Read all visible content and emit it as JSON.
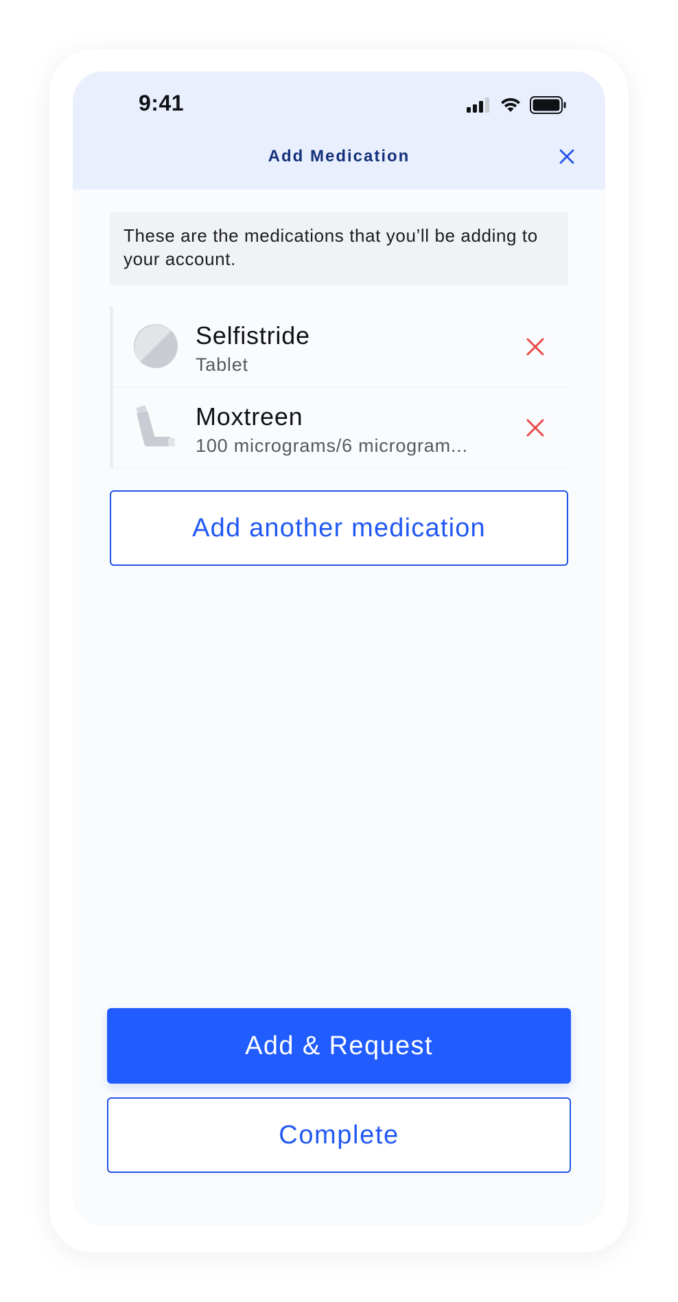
{
  "status_bar": {
    "time": "9:41",
    "icons": [
      "cellular-signal-icon",
      "wifi-icon",
      "battery-icon"
    ]
  },
  "header": {
    "title": "Add Medication",
    "close_icon": "close-icon"
  },
  "info_text": "These are the medications that you’ll be adding to your account.",
  "medications": [
    {
      "name": "Selfistride",
      "detail": "Tablet",
      "icon": "tablet-icon",
      "remove_icon": "remove-icon"
    },
    {
      "name": "Moxtreen",
      "detail": "100 micrograms/6 microgram...",
      "icon": "inhaler-icon",
      "remove_icon": "remove-icon"
    }
  ],
  "buttons": {
    "add_another": "Add another medication",
    "add_request": "Add & Request",
    "complete": "Complete"
  },
  "colors": {
    "primary": "#215cff",
    "header_bg": "#e9effc",
    "header_title": "#13307a",
    "remove": "#e84a4a",
    "icon_gray": "#c9ccd2"
  }
}
